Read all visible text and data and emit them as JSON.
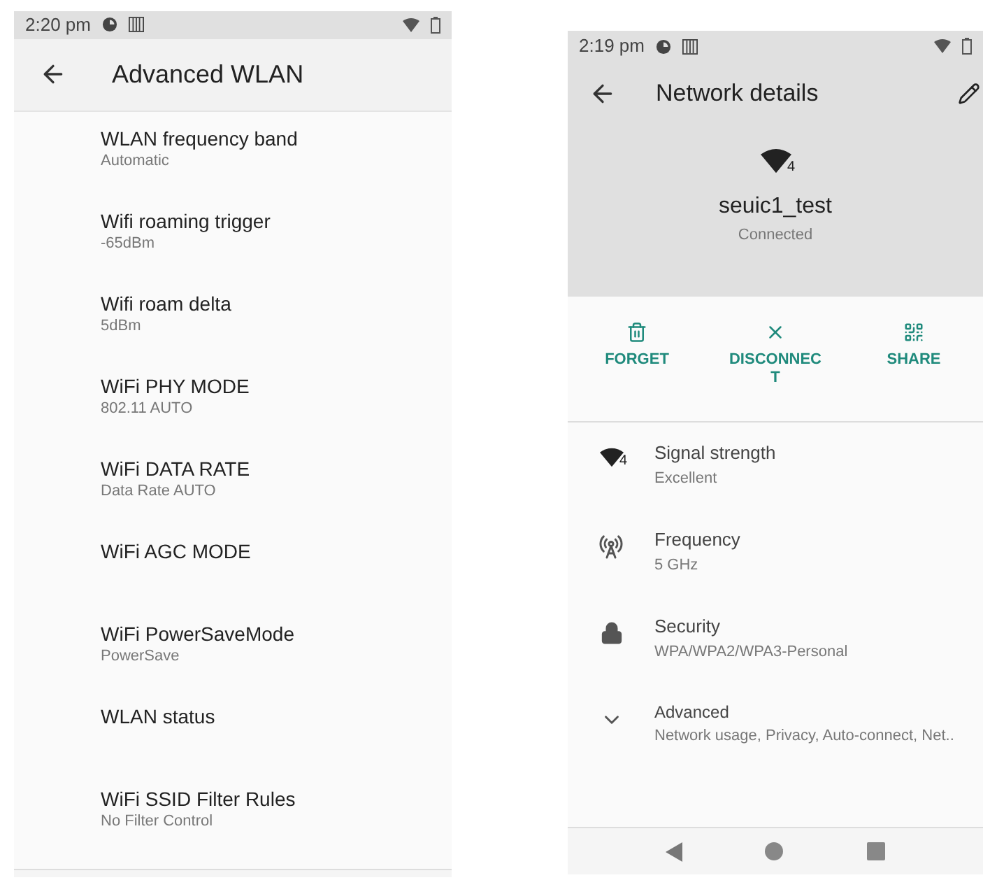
{
  "left_screen": {
    "status_bar": {
      "time": "2:20 pm"
    },
    "app_bar": {
      "title": "Advanced WLAN"
    },
    "settings": [
      {
        "title": "WLAN frequency band",
        "summary": "Automatic"
      },
      {
        "title": "Wifi roaming trigger",
        "summary": "-65dBm"
      },
      {
        "title": "Wifi roam delta",
        "summary": "5dBm"
      },
      {
        "title": "WiFi PHY MODE",
        "summary": "802.11 AUTO"
      },
      {
        "title": "WiFi DATA RATE",
        "summary": "Data Rate AUTO"
      },
      {
        "title": "WiFi AGC MODE"
      },
      {
        "title": "WiFi PowerSaveMode",
        "summary": "PowerSave"
      },
      {
        "title": "WLAN status"
      },
      {
        "title": "WiFi SSID Filter Rules",
        "summary": "No Filter Control"
      }
    ]
  },
  "right_screen": {
    "status_bar": {
      "time": "2:19 pm"
    },
    "app_bar": {
      "title": "Network details"
    },
    "network": {
      "name": "seuic1_test",
      "status": "Connected",
      "signal": "4"
    },
    "actions": [
      {
        "label": "FORGET"
      },
      {
        "label": "DISCONNEC\nT"
      },
      {
        "label": "SHARE"
      }
    ],
    "details": [
      {
        "title": "Signal strength",
        "value": "Excellent",
        "signal": "4"
      },
      {
        "title": "Frequency",
        "value": "5 GHz"
      },
      {
        "title": "Security",
        "value": "WPA/WPA2/WPA3-Personal"
      },
      {
        "title": "Advanced",
        "value": "Network usage, Privacy, Auto-connect, Net.."
      }
    ]
  }
}
